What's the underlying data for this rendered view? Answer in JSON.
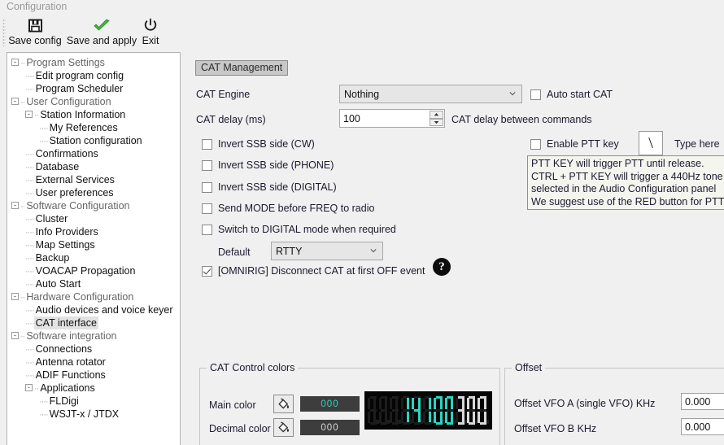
{
  "window": {
    "title": "Configuration"
  },
  "toolbar": {
    "buttons": [
      {
        "label": "Save config",
        "icon": "floppy-disk-icon"
      },
      {
        "label": "Save and apply",
        "icon": "green-check-icon"
      },
      {
        "label": "Exit",
        "icon": "power-icon"
      }
    ]
  },
  "sidebar": {
    "items": [
      {
        "label": "Program Settings",
        "level": 0,
        "expander": "-",
        "dim": true,
        "selected": false
      },
      {
        "label": "Edit program config",
        "level": 1,
        "expander": "",
        "dim": false,
        "selected": false
      },
      {
        "label": "Program Scheduler",
        "level": 1,
        "expander": "",
        "dim": false,
        "selected": false
      },
      {
        "label": "User Configuration",
        "level": 0,
        "expander": "-",
        "dim": true,
        "selected": false
      },
      {
        "label": "Station Information",
        "level": 1,
        "expander": "-",
        "dim": false,
        "selected": false
      },
      {
        "label": "My References",
        "level": 2,
        "expander": "",
        "dim": false,
        "selected": false
      },
      {
        "label": "Station configuration",
        "level": 2,
        "expander": "",
        "dim": false,
        "selected": false
      },
      {
        "label": "Confirmations",
        "level": 1,
        "expander": "",
        "dim": false,
        "selected": false
      },
      {
        "label": "Database",
        "level": 1,
        "expander": "",
        "dim": false,
        "selected": false
      },
      {
        "label": "External Services",
        "level": 1,
        "expander": "",
        "dim": false,
        "selected": false
      },
      {
        "label": "User preferences",
        "level": 1,
        "expander": "",
        "dim": false,
        "selected": false
      },
      {
        "label": "Software Configuration",
        "level": 0,
        "expander": "-",
        "dim": true,
        "selected": false
      },
      {
        "label": "Cluster",
        "level": 1,
        "expander": "",
        "dim": false,
        "selected": false
      },
      {
        "label": "Info Providers",
        "level": 1,
        "expander": "",
        "dim": false,
        "selected": false
      },
      {
        "label": "Map Settings",
        "level": 1,
        "expander": "",
        "dim": false,
        "selected": false
      },
      {
        "label": "Backup",
        "level": 1,
        "expander": "",
        "dim": false,
        "selected": false
      },
      {
        "label": "VOACAP Propagation",
        "level": 1,
        "expander": "",
        "dim": false,
        "selected": false
      },
      {
        "label": "Auto Start",
        "level": 1,
        "expander": "",
        "dim": false,
        "selected": false
      },
      {
        "label": "Hardware Configuration",
        "level": 0,
        "expander": "-",
        "dim": true,
        "selected": false
      },
      {
        "label": "Audio devices and voice keyer",
        "level": 1,
        "expander": "",
        "dim": false,
        "selected": false
      },
      {
        "label": "CAT interface",
        "level": 1,
        "expander": "",
        "dim": false,
        "selected": true
      },
      {
        "label": "Software integration",
        "level": 0,
        "expander": "-",
        "dim": true,
        "selected": false
      },
      {
        "label": "Connections",
        "level": 1,
        "expander": "",
        "dim": false,
        "selected": false
      },
      {
        "label": "Antenna rotator",
        "level": 1,
        "expander": "",
        "dim": false,
        "selected": false
      },
      {
        "label": "ADIF Functions",
        "level": 1,
        "expander": "",
        "dim": false,
        "selected": false
      },
      {
        "label": "Applications",
        "level": 1,
        "expander": "-",
        "dim": false,
        "selected": false
      },
      {
        "label": "FLDigi",
        "level": 2,
        "expander": "",
        "dim": false,
        "selected": false
      },
      {
        "label": "WSJT-x / JTDX",
        "level": 2,
        "expander": "",
        "dim": false,
        "selected": false
      }
    ]
  },
  "main": {
    "tab_label": "CAT Management",
    "cat_engine": {
      "label": "CAT Engine",
      "value": "Nothing"
    },
    "cat_delay": {
      "label": "CAT delay (ms)",
      "value": "100",
      "hint": "CAT delay between commands"
    },
    "auto_start_cat": {
      "label": "Auto start CAT",
      "checked": false
    },
    "enable_ptt_key": {
      "label": "Enable PTT key",
      "checked": false,
      "key_value": "\\",
      "type_here": "Type here"
    },
    "ptt_info": [
      "PTT KEY will trigger PTT until release.",
      "CTRL + PTT KEY will trigger a 440Hz tone",
      "selected in the Audio Configuration panel",
      "We suggest use of the RED button for PTT"
    ],
    "checkboxes": [
      {
        "label": "Invert SSB side (CW)",
        "checked": false
      },
      {
        "label": "Invert SSB side (PHONE)",
        "checked": false
      },
      {
        "label": "Invert SSB side (DIGITAL)",
        "checked": false
      },
      {
        "label": "Send MODE before FREQ to radio",
        "checked": false
      },
      {
        "label": "Switch to DIGITAL mode when required",
        "checked": false
      }
    ],
    "default_mode": {
      "label": "Default",
      "value": "RTTY"
    },
    "omnirig": {
      "label": "[OMNIRIG] Disconnect CAT at first OFF event",
      "checked": true
    },
    "help_glyph": "?"
  },
  "cat_control_colors": {
    "title": "CAT Control colors",
    "main_color": {
      "label": "Main color",
      "value": "000",
      "swatch_hex": "#2ad4c0"
    },
    "decimal_color": {
      "label": "Decimal color",
      "value": "000",
      "swatch_hex": "#d8d8d8"
    },
    "lcd": {
      "background_hex": "#050505",
      "main_hex": "#2ad4c0",
      "decimal_hex": "#d8d8d8",
      "off_hex": "#1c1c1c",
      "frequency": "00014.100300",
      "digits": [
        {
          "char": "0",
          "state": "off"
        },
        {
          "char": "0",
          "state": "off"
        },
        {
          "char": "0",
          "state": "off"
        },
        {
          "char": "1",
          "state": "main"
        },
        {
          "char": "4",
          "state": "main"
        },
        {
          "char": "1",
          "state": "main"
        },
        {
          "char": "0",
          "state": "main"
        },
        {
          "char": "0",
          "state": "main"
        },
        {
          "char": "3",
          "state": "decimal"
        },
        {
          "char": "0",
          "state": "decimal"
        },
        {
          "char": "0",
          "state": "decimal"
        }
      ]
    }
  },
  "offset": {
    "title": "Offset",
    "rows": [
      {
        "label": "Offset VFO A (single VFO) KHz",
        "value": "0.000"
      },
      {
        "label": "Offset VFO B KHz",
        "value": "0.000"
      }
    ]
  }
}
